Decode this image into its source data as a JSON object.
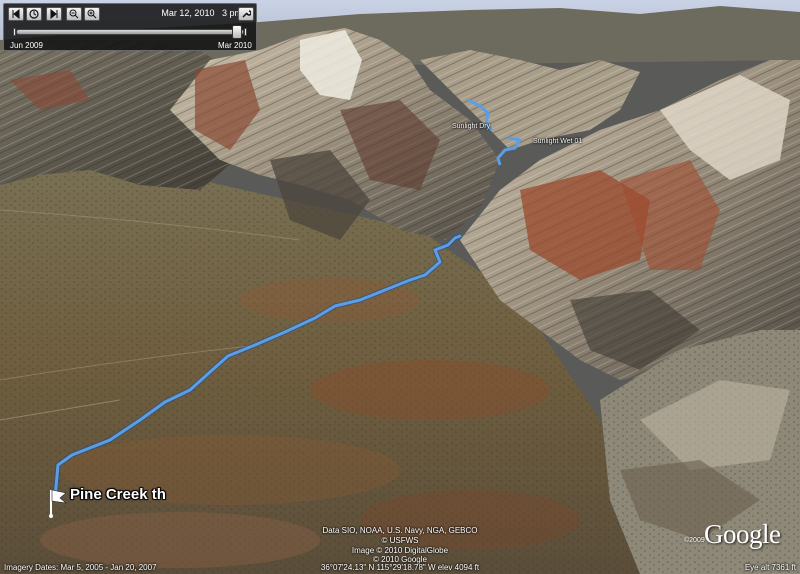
{
  "time_slider": {
    "current_date": "Mar 12, 2010",
    "current_time": "3 pm",
    "range_start": "Jun 2009",
    "range_end": "Mar 2010"
  },
  "map": {
    "trailhead_label": "Pine Creek th",
    "waypoints": [
      "Sunlight Dry",
      "Sunlight Wet 01"
    ],
    "route_color": "#5b9ee6"
  },
  "credits": {
    "data_line": "Data SIO, NOAA, U.S. Navy, NGA, GEBCO",
    "usgs_line": "© USFWS",
    "image_line": "Image © 2010 DigitalGlobe",
    "google_line": "© 2010 Google"
  },
  "status_bar": {
    "imagery_dates": "Imagery Dates: Mar 5, 2005 - Jan 20, 2007",
    "coordinates": "36°07'24.13\" N    115°29'18.78\" W    elev  4094 ft",
    "eye_alt": "Eye alt   7361 ft"
  },
  "logo": {
    "copyright": "©2009",
    "text": "Google"
  }
}
